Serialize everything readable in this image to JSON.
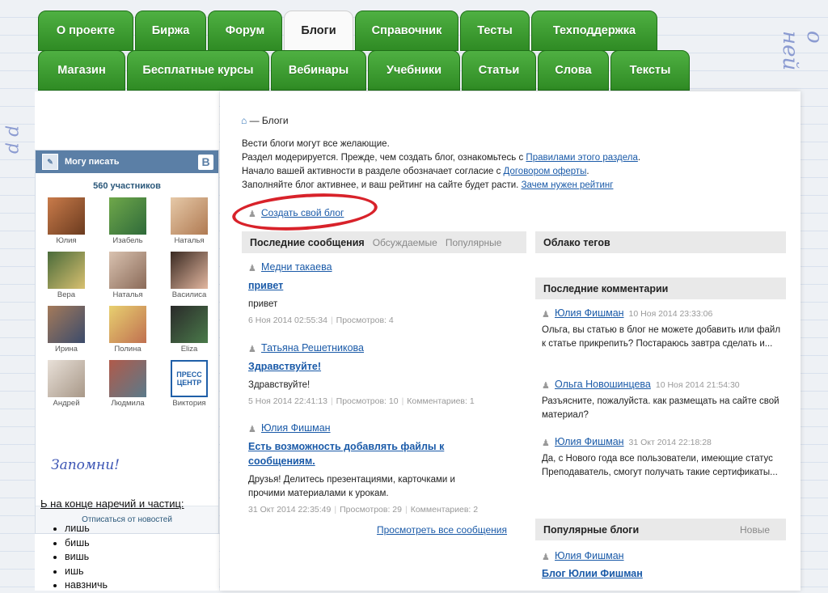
{
  "nav": {
    "row1": [
      "О проекте",
      "Биржа",
      "Форум",
      "Блоги",
      "Справочник",
      "Тесты",
      "Техподдержка"
    ],
    "row2": [
      "Магазин",
      "Бесплатные курсы",
      "Вебинары",
      "Учебники",
      "Статьи",
      "Слова",
      "Тексты"
    ],
    "active": "Блоги"
  },
  "vk": {
    "title": "Могу писать",
    "logo": "B",
    "count": "560 участников",
    "members": [
      "Юлия",
      "Изабель",
      "Наталья",
      "Вера",
      "Наталья",
      "Василиса",
      "Ирина",
      "Полина",
      "Eliza",
      "Андрей",
      "Людмила",
      "Виктория"
    ],
    "press_logo_text": "ПРЕСС ЦЕНТР",
    "unsubscribe": "Отписаться от новостей"
  },
  "sidebar_notes": {
    "remember": "Запомни!",
    "rule": "Ь на конце наречий и частиц:",
    "words": [
      "лишь",
      "бишь",
      "вишь",
      "ишь",
      "навзничь"
    ]
  },
  "breadcrumb": {
    "current": "— Блоги"
  },
  "intro": {
    "line1": "Вести блоги могут все желающие.",
    "line2_pre": "Раздел модерируется. Прежде, чем создать блог, ознакомьтесь с ",
    "line2_link": "Правилами этого раздела",
    "line2_post": ".",
    "line3_pre": "Начало вашей активности в разделе обозначает согласие с ",
    "line3_link": "Договором оферты",
    "line3_post": ".",
    "line4_pre": "Заполняйте блог активнее, и ваш рейтинг на сайте будет расти. ",
    "line4_link": "Зачем нужен рейтинг"
  },
  "create_blog": "Создать свой блог",
  "messages": {
    "heading": "Последние сообщения",
    "tab_discussed": "Обсуждаемые",
    "tab_popular": "Популярные",
    "posts": [
      {
        "author": "Медни такаева",
        "title": "привет",
        "body": "привет",
        "date": "6 Ноя 2014 02:55:34",
        "views": "Просмотров: 4",
        "comments": ""
      },
      {
        "author": "Татьяна Решетникова",
        "title": "Здравствуйте!",
        "body": "Здравствуйте!",
        "date": "5 Ноя 2014 22:41:13",
        "views": "Просмотров: 10",
        "comments": "Комментариев: 1"
      },
      {
        "author": "Юлия Фишман",
        "title": "Есть возможность добавлять файлы к сообщениям.",
        "body": "Друзья! Делитесь презентациями, карточками и прочими материалами к урокам.",
        "date": "31 Окт 2014 22:35:49",
        "views": "Просмотров: 29",
        "comments": "Комментариев: 2"
      }
    ],
    "view_all": "Просмотреть все сообщения"
  },
  "tags": {
    "heading": "Облако тегов"
  },
  "comments": {
    "heading": "Последние комментарии",
    "items": [
      {
        "author": "Юлия Фишман",
        "date": "10 Ноя 2014 23:33:06",
        "text": "Ольга, вы статью в блог не можете добавить или файл к статье прикрепить? Постараюсь завтра сделать и..."
      },
      {
        "author": "Ольга Новошинцева",
        "date": "10 Ноя 2014 21:54:30",
        "text": "Разъясните, пожалуйста. как размещать на сайте свой материал?"
      },
      {
        "author": "Юлия Фишман",
        "date": "31 Окт 2014 22:18:28",
        "text": "Да, с Нового года все пользователи, имеющие статус Преподаватель, смогут получать такие сертификаты..."
      }
    ]
  },
  "popular_blogs": {
    "heading": "Популярные блоги",
    "tab_new": "Новые",
    "author": "Юлия Фишман",
    "blog": "Блог Юлии Фишман"
  },
  "colors": {
    "tab_green": "#3a9a2e",
    "link": "#1a5aa8",
    "vk_blue": "#5b7fa6",
    "red_oval": "#d8222a"
  },
  "icons": {
    "home": "home-icon",
    "user": "user-icon"
  }
}
